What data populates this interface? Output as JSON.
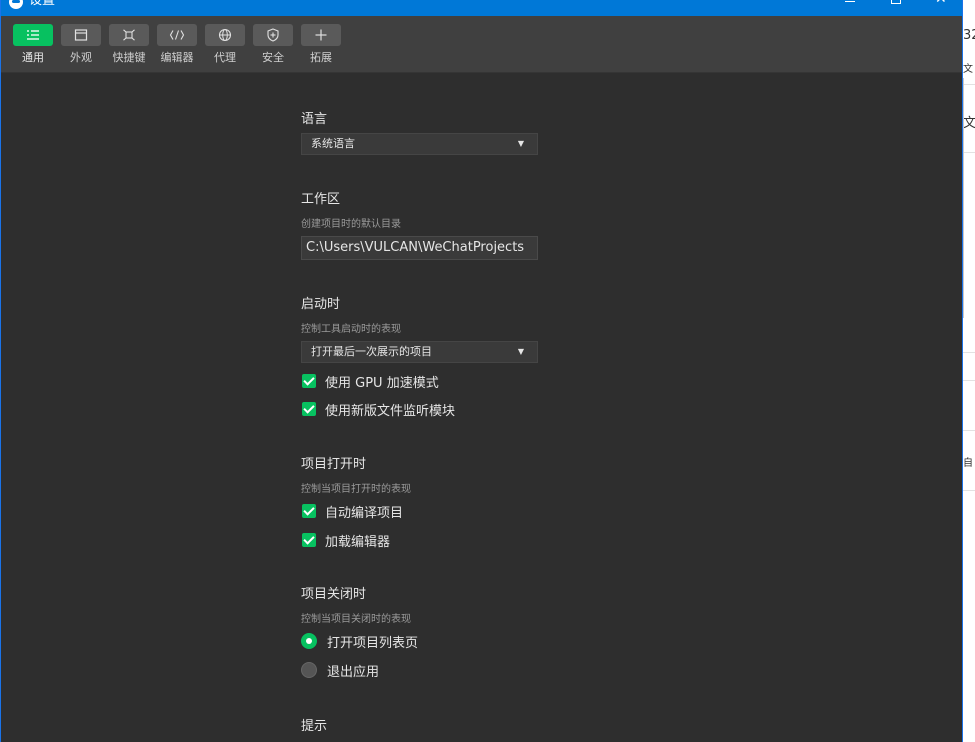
{
  "window": {
    "title": "设置"
  },
  "background_fragments": [
    "32",
    "文",
    "文",
    "自"
  ],
  "toolbar": {
    "tabs": [
      {
        "label": "通用",
        "icon": "list-settings-icon",
        "active": true
      },
      {
        "label": "外观",
        "icon": "window-layout-icon",
        "active": false
      },
      {
        "label": "快捷键",
        "icon": "command-key-icon",
        "active": false
      },
      {
        "label": "编辑器",
        "icon": "code-brackets-icon",
        "active": false
      },
      {
        "label": "代理",
        "icon": "globe-icon",
        "active": false
      },
      {
        "label": "安全",
        "icon": "shield-icon",
        "active": false
      },
      {
        "label": "拓展",
        "icon": "plus-icon",
        "active": false
      }
    ],
    "accent": "#07c160"
  },
  "settings": {
    "language": {
      "title": "语言",
      "value": "系统语言"
    },
    "workspace": {
      "title": "工作区",
      "desc": "创建项目时的默认目录",
      "value": "C:\\Users\\VULCAN\\WeChatProjects"
    },
    "startup": {
      "title": "启动时",
      "desc": "控制工具启动时的表现",
      "value": "打开最后一次展示的项目",
      "options": [
        {
          "label": "使用 GPU 加速模式",
          "checked": true
        },
        {
          "label": "使用新版文件监听模块",
          "checked": true
        }
      ]
    },
    "project_open": {
      "title": "项目打开时",
      "desc": "控制当项目打开时的表现",
      "options": [
        {
          "label": "自动编译项目",
          "checked": true
        },
        {
          "label": "加载编辑器",
          "checked": true
        }
      ]
    },
    "project_close": {
      "title": "项目关闭时",
      "desc": "控制当项目关闭时的表现",
      "options": [
        {
          "label": "打开项目列表页",
          "selected": true
        },
        {
          "label": "退出应用",
          "selected": false
        }
      ]
    },
    "hints": {
      "title": "提示"
    }
  }
}
